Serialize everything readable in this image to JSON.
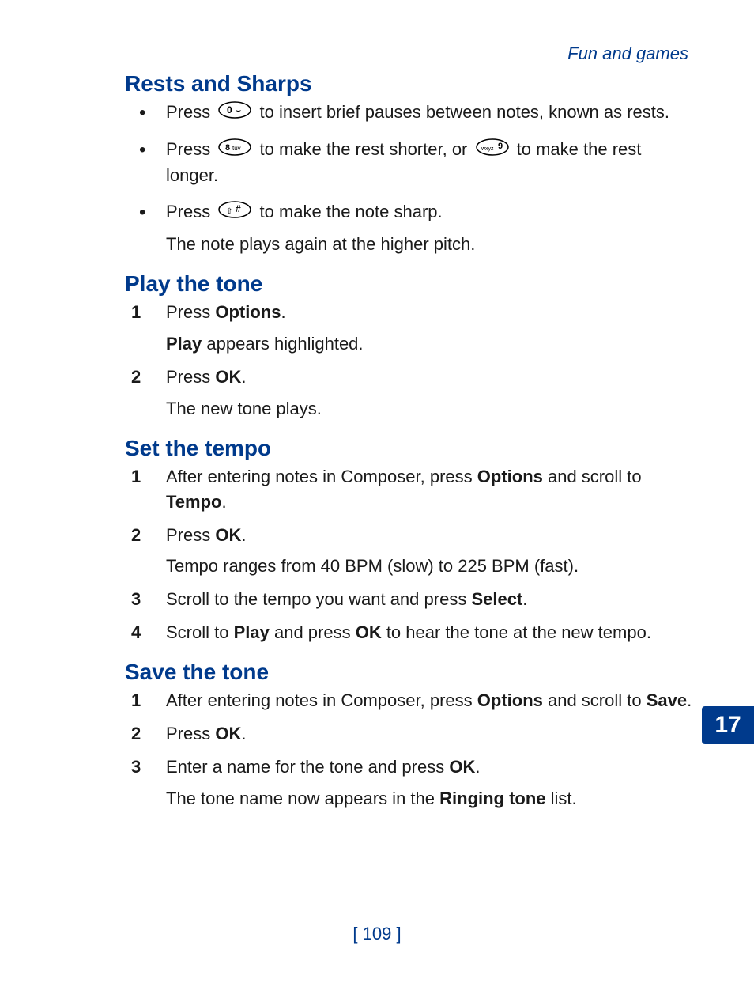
{
  "header": "Fun and games",
  "sections": {
    "rests": {
      "title": "Rests and Sharps",
      "b1a": "Press ",
      "b1b": " to insert brief pauses between notes, known as rests.",
      "b2a": "Press ",
      "b2b": " to make the rest shorter, or ",
      "b2c": " to make the rest longer.",
      "b3a": "Press ",
      "b3b": " to make the note sharp.",
      "b3sub": "The note plays again at the higher pitch."
    },
    "play": {
      "title": "Play the tone",
      "s1a": "Press ",
      "s1b": "Options",
      "s1c": ".",
      "s1sub_a": "Play",
      "s1sub_b": " appears highlighted.",
      "s2a": "Press ",
      "s2b": "OK",
      "s2c": ".",
      "s2sub": "The new tone plays."
    },
    "tempo": {
      "title": "Set the tempo",
      "s1a": "After entering notes in Composer, press ",
      "s1b": "Options",
      "s1c": " and scroll to ",
      "s1d": "Tempo",
      "s1e": ".",
      "s2a": "Press ",
      "s2b": "OK",
      "s2c": ".",
      "s2sub": "Tempo ranges from 40 BPM (slow) to 225 BPM (fast).",
      "s3a": "Scroll to the tempo you want and press ",
      "s3b": "Select",
      "s3c": ".",
      "s4a": "Scroll to ",
      "s4b": "Play",
      "s4c": " and press ",
      "s4d": "OK",
      "s4e": " to hear the tone at the new tempo."
    },
    "save": {
      "title": "Save the tone",
      "s1a": "After entering notes in Composer, press ",
      "s1b": "Options",
      "s1c": " and scroll to ",
      "s1d": "Save",
      "s1e": ".",
      "s2a": "Press ",
      "s2b": "OK",
      "s2c": ".",
      "s3a": "Enter a name for the tone and press ",
      "s3b": "OK",
      "s3c": ".",
      "s3sub_a": "The tone name now appears in the ",
      "s3sub_b": "Ringing tone",
      "s3sub_c": " list."
    }
  },
  "chapter": "17",
  "page": "[ 109 ]",
  "nums": {
    "n1": "1",
    "n2": "2",
    "n3": "3",
    "n4": "4"
  }
}
